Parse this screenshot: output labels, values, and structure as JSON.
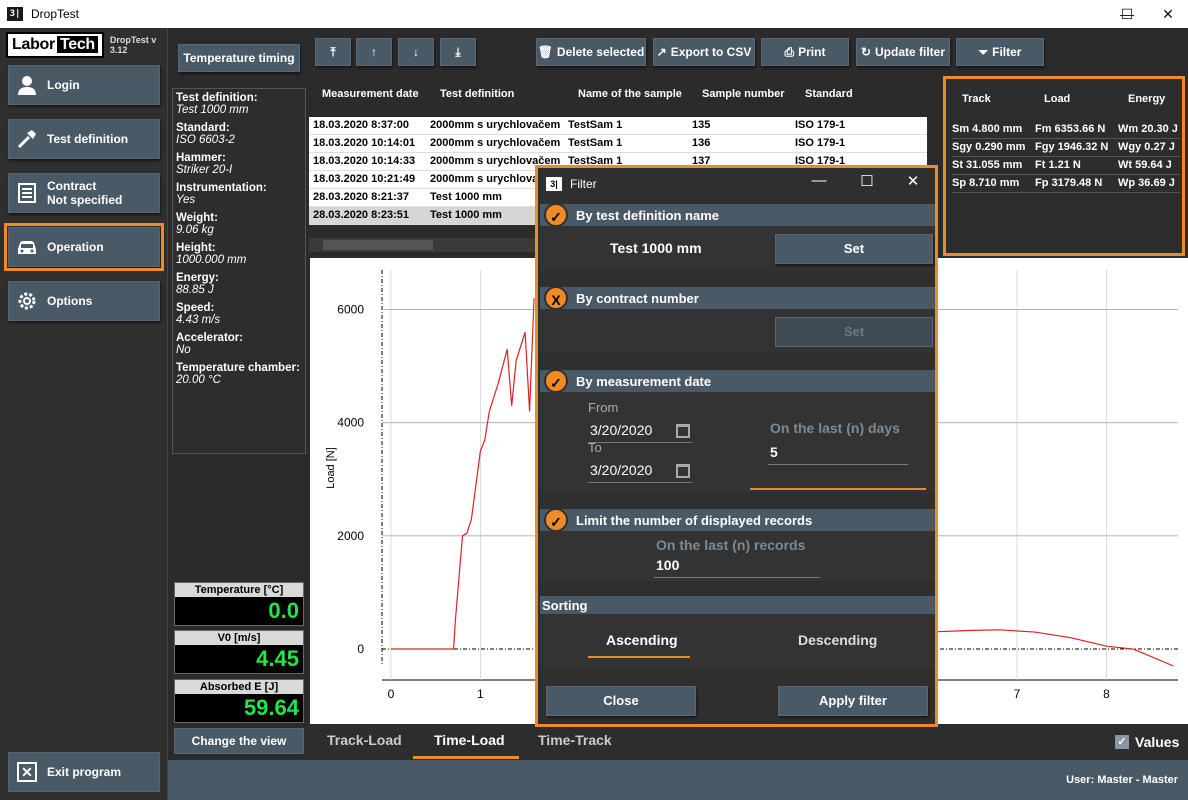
{
  "window": {
    "title": "DropTest",
    "icon_text": "3|"
  },
  "brand": {
    "logo_part1": "Labor",
    "logo_part2": "Tech",
    "version": "DropTest v 3.12"
  },
  "sidebar": {
    "login": "Login",
    "test_definition": "Test definition",
    "contract_line1": "Contract",
    "contract_line2": "Not specified",
    "operation": "Operation",
    "options": "Options",
    "exit": "Exit program"
  },
  "info": {
    "temp_timing": "Temperature timing",
    "items": [
      {
        "k": "Test definition:",
        "v": "Test 1000 mm"
      },
      {
        "k": "Standard:",
        "v": "ISO 6603-2"
      },
      {
        "k": "Hammer:",
        "v": "Striker 20-I"
      },
      {
        "k": "Instrumentation:",
        "v": "Yes"
      },
      {
        "k": "Weight:",
        "v": "9.06   kg"
      },
      {
        "k": "Height:",
        "v": "1000.000   mm"
      },
      {
        "k": "Energy:",
        "v": "88.85   J"
      },
      {
        "k": "Speed:",
        "v": "4.43   m/s"
      },
      {
        "k": "Accelerator:",
        "v": "No"
      },
      {
        "k": "Temperature chamber:",
        "v": "20.00 °C"
      }
    ],
    "readouts": [
      {
        "label": "Temperature [°C]",
        "value": "0.0"
      },
      {
        "label": "V0 [m/s]",
        "value": "4.45"
      },
      {
        "label": "Absorbed E [J]",
        "value": "59.64"
      }
    ],
    "change_view": "Change the view"
  },
  "toolbar": {
    "delete": "Delete selected",
    "export": "Export to CSV",
    "print": "Print",
    "update_filter": "Update filter",
    "filter": "Filter"
  },
  "table": {
    "headers": [
      "Measurement date",
      "Test definition",
      "Name of the sample",
      "Sample number",
      "Standard"
    ],
    "rows": [
      [
        "18.03.2020 8:37:00",
        "2000mm s urychlovačem",
        "TestSam 1",
        "135",
        "ISO 179-1"
      ],
      [
        "18.03.2020 10:14:01",
        "2000mm s urychlovačem",
        "TestSam 1",
        "136",
        "ISO 179-1"
      ],
      [
        "18.03.2020 10:14:33",
        "2000mm s urychlovačem",
        "TestSam 1",
        "137",
        "ISO 179-1"
      ],
      [
        "18.03.2020 10:21:49",
        "2000mm s urychlovačem",
        "",
        "",
        ""
      ],
      [
        "28.03.2020 8:21:37",
        "Test 1000 mm",
        "",
        "",
        ""
      ],
      [
        "28.03.2020 8:23:51",
        "Test 1000 mm",
        "",
        "",
        ""
      ]
    ]
  },
  "results": {
    "headers": [
      "Track",
      "Load",
      "Energy"
    ],
    "rows": [
      [
        "Sm 4.800 mm",
        "Fm 6353.66 N",
        "Wm 20.30 J"
      ],
      [
        "Sgy 0.290 mm",
        "Fgy 1946.32 N",
        "Wgy 0.27 J"
      ],
      [
        "St 31.055 mm",
        "Ft 1.21 N",
        "Wt 59.64 J"
      ],
      [
        "Sp 8.710 mm",
        "Fp 3179.48 N",
        "Wp 36.69 J"
      ]
    ]
  },
  "chart_data": {
    "type": "line",
    "ylabel": "Load [N]",
    "xlabel": "",
    "xlim": [
      -0.1,
      8.8
    ],
    "ylim": [
      -300,
      6700
    ],
    "xticks": [
      "0",
      "1",
      "7",
      "8"
    ],
    "yticks": [
      "0",
      "2000",
      "4000",
      "6000"
    ],
    "series": [
      {
        "color": "#e02020",
        "x": [
          0,
          0.7,
          0.72,
          0.8,
          0.85,
          0.9,
          1.0,
          1.05,
          1.1,
          1.2,
          1.3,
          1.35,
          1.4,
          1.5,
          1.55,
          1.6
        ],
        "y": [
          0,
          0,
          500,
          2000,
          2050,
          2300,
          3500,
          3700,
          4200,
          4700,
          5300,
          4300,
          5100,
          5600,
          4200,
          6200
        ]
      },
      {
        "color": "#e02020",
        "x": [
          6.0,
          6.5,
          6.8,
          7.2,
          7.6,
          8.0,
          8.3,
          8.75
        ],
        "y": [
          300,
          330,
          340,
          300,
          200,
          50,
          0,
          -300
        ]
      }
    ]
  },
  "tabs": {
    "track_load": "Track-Load",
    "time_load": "Time-Load",
    "time_track": "Time-Track",
    "values": "Values"
  },
  "status": {
    "user": "User:  Master  -  Master"
  },
  "filter": {
    "title": "Filter",
    "sec1": "By test definition name",
    "sec1_value": "Test 1000 mm",
    "set": "Set",
    "sec2": "By contract number",
    "sec3": "By measurement date",
    "from": "From",
    "from_value": "3/20/2020",
    "to": "To",
    "to_value": "3/20/2020",
    "last_days_label": "On the last (n) days",
    "last_days_value": "5",
    "sec4": "Limit the number of displayed records",
    "last_records_label": "On the last (n) records",
    "last_records_value": "100",
    "sorting": "Sorting",
    "ascending": "Ascending",
    "descending": "Descending",
    "close": "Close",
    "apply": "Apply filter"
  }
}
